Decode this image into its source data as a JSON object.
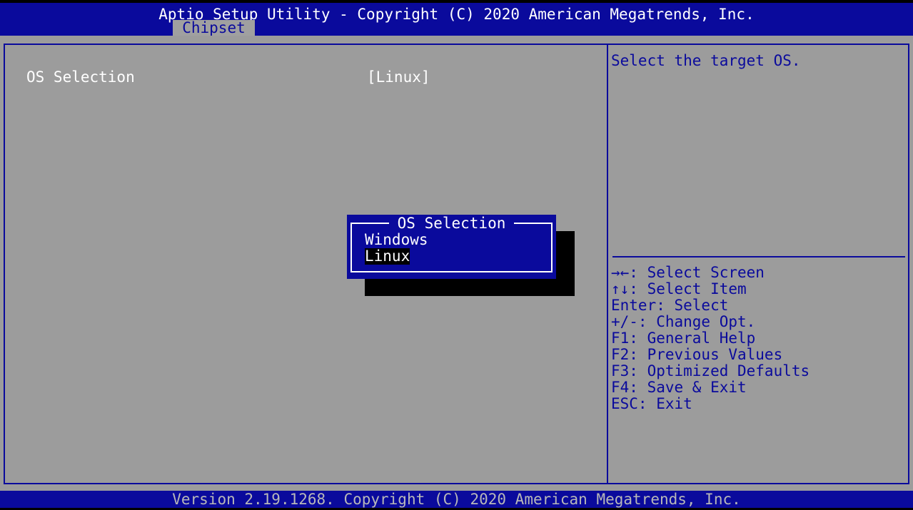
{
  "header": {
    "title": "Aptio Setup Utility - Copyright (C) 2020 American Megatrends, Inc.",
    "active_tab": "Chipset"
  },
  "main": {
    "items": [
      {
        "label": "OS Selection",
        "value": "[Linux]"
      }
    ]
  },
  "help": {
    "description": "Select the target OS.",
    "keys": [
      "→←: Select Screen",
      "↑↓: Select Item",
      "Enter: Select",
      "+/-: Change Opt.",
      "F1: General Help",
      "F2: Previous Values",
      "F3: Optimized Defaults",
      "F4: Save & Exit",
      "ESC: Exit"
    ]
  },
  "popup": {
    "title": "OS Selection",
    "options": [
      "Windows",
      "Linux"
    ],
    "selected": "Linux"
  },
  "footer": {
    "text": "Version 2.19.1268. Copyright (C) 2020 American Megatrends, Inc."
  },
  "colors": {
    "blue": "#0a0a9c",
    "grey": "#9c9c9c"
  }
}
